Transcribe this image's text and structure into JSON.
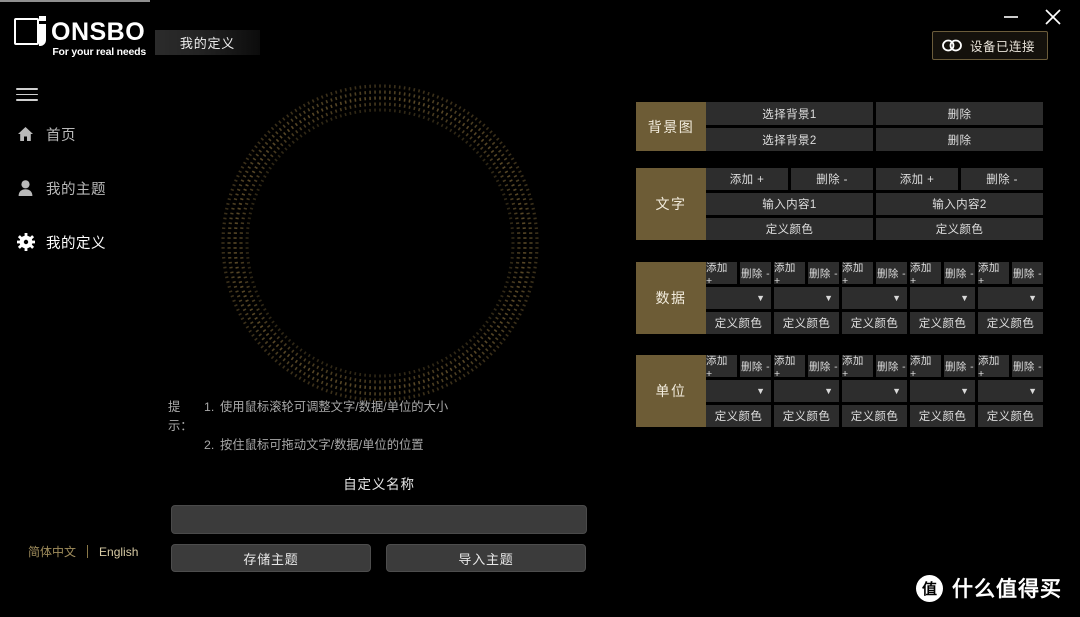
{
  "window": {
    "minimize_label": "−",
    "close_label": "×"
  },
  "brand": {
    "name": "ONSBO",
    "tagline": "For your real needs",
    "logo_icon": "jonsbo-logo-icon"
  },
  "connection": {
    "status_label": "设备已连接",
    "icon": "link-chain-icon",
    "border_color": "#6b5c3b"
  },
  "tab": {
    "label": "我的定义"
  },
  "sidebar": {
    "menu_icon": "hamburger-menu-icon",
    "items": [
      {
        "label": "首页",
        "icon": "home-icon",
        "active": false
      },
      {
        "label": "我的主题",
        "icon": "user-icon",
        "active": false
      },
      {
        "label": "我的定义",
        "icon": "gear-icon",
        "active": true
      }
    ]
  },
  "preview": {
    "shape": "concentric-dotted-ring",
    "dot_color": "#6b5830"
  },
  "hints": {
    "lead": "提示：",
    "items": [
      {
        "num": "1.",
        "text": "使用鼠标滚轮可调整文字/数据/单位的大小"
      },
      {
        "num": "2.",
        "text": "按住鼠标可拖动文字/数据/单位的位置"
      }
    ]
  },
  "custom_name": {
    "title": "自定义名称",
    "input_value": "",
    "input_placeholder": "",
    "save_label": "存储主题",
    "import_label": "导入主题"
  },
  "language": {
    "zh_label": "简体中文",
    "en_label": "English",
    "accent_color": "#a08d5c"
  },
  "panel": {
    "accent_color": "#6d5c36",
    "background_image": {
      "label": "背景图",
      "rows": [
        {
          "select_label": "选择背景1",
          "delete_label": "删除"
        },
        {
          "select_label": "选择背景2",
          "delete_label": "删除"
        }
      ]
    },
    "text": {
      "label": "文字",
      "add_label": "添加 +",
      "remove_label": "删除 -",
      "columns": [
        {
          "input_label": "输入内容1",
          "color_label": "定义颜色"
        },
        {
          "input_label": "输入内容2",
          "color_label": "定义颜色"
        }
      ]
    },
    "data": {
      "label": "数据",
      "add_label": "添加 +",
      "remove_label": "删除 -",
      "color_label": "定义颜色",
      "dropdown_value": "",
      "dropdown_arrow": "▼",
      "column_count": 5
    },
    "unit": {
      "label": "单位",
      "add_label": "添加 +",
      "remove_label": "删除 -",
      "color_label": "定义颜色",
      "dropdown_value": "",
      "dropdown_arrow": "▼",
      "column_count": 5
    }
  },
  "watermark": {
    "badge": "值",
    "text": "什么值得买"
  }
}
